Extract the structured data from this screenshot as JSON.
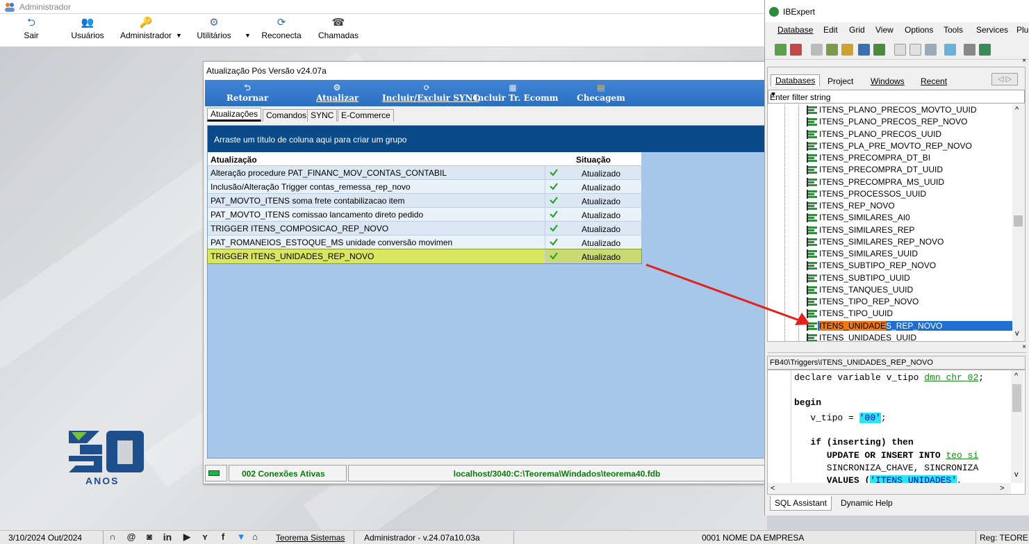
{
  "app": {
    "title": "Administrador",
    "toolbar": [
      {
        "label": "Sair",
        "icon": "exit-icon"
      },
      {
        "label": "Usuários",
        "icon": "users-icon"
      },
      {
        "label": "Administrador",
        "icon": "key-icon"
      },
      {
        "label": "Utilitários",
        "icon": "tools-icon"
      },
      {
        "label": "Reconecta",
        "icon": "refresh-icon"
      },
      {
        "label": "Chamadas",
        "icon": "headset-icon"
      }
    ]
  },
  "logo": {
    "text": "ANOS",
    "number": "30"
  },
  "dialog": {
    "title": "Atualização Pós Versão v24.07a",
    "toolbar": [
      {
        "label": "Retornar",
        "icon": "back-icon"
      },
      {
        "label": "Atualizar",
        "icon": "gear-icon"
      },
      {
        "label": "Incluir/Excluir SYNC",
        "icon": "sync-icon"
      },
      {
        "label": "Incluir Tr. Ecomm",
        "icon": "grid-icon"
      },
      {
        "label": "Checagem",
        "icon": "check-doc-icon"
      }
    ],
    "tabs": [
      "Atualizações",
      "Comandos",
      "SYNC",
      "E-Commerce"
    ],
    "group_hint": "Arraste um título de coluna aqui para criar um grupo",
    "columns": [
      "Atualização",
      "Situação"
    ],
    "rows": [
      {
        "name": "Alteração procedure PAT_FINANC_MOV_CONTAS_CONTABIL",
        "status": "Atualizado"
      },
      {
        "name": "Inclusão/Alteração Trigger contas_remessa_rep_novo",
        "status": "Atualizado"
      },
      {
        "name": "PAT_MOVTO_ITENS soma frete contabilizacao item",
        "status": "Atualizado"
      },
      {
        "name": "PAT_MOVTO_ITENS comissao lancamento direto pedido",
        "status": "Atualizado"
      },
      {
        "name": "TRIGGER ITENS_COMPOSICAO_REP_NOVO",
        "status": "Atualizado"
      },
      {
        "name": "PAT_ROMANEIOS_ESTOQUE_MS unidade conversão movimen",
        "status": "Atualizado"
      },
      {
        "name": "TRIGGER ITENS_UNIDADES_REP_NOVO",
        "status": "Atualizado"
      }
    ],
    "status_connections": "002 Conexões Ativas",
    "status_db": "localhost/3040:C:\\Teorema\\Windados\\teorema40.fdb"
  },
  "ibexpert": {
    "title": "IBExpert",
    "menu": [
      "Database",
      "Edit",
      "Grid",
      "View",
      "Options",
      "Tools",
      "Services",
      "Plu"
    ],
    "tabs": [
      "Databases",
      "Project",
      "Windows",
      "Recent"
    ],
    "filter_placeholder": "Enter filter string",
    "tree": [
      "ITENS_PLANO_PRECOS_MOVTO_UUID",
      "ITENS_PLANO_PRECOS_REP_NOVO",
      "ITENS_PLANO_PRECOS_UUID",
      "ITENS_PLA_PRE_MOVTO_REP_NOVO",
      "ITENS_PRECOMPRA_DT_BI",
      "ITENS_PRECOMPRA_DT_UUID",
      "ITENS_PRECOMPRA_MS_UUID",
      "ITENS_PROCESSOS_UUID",
      "ITENS_REP_NOVO",
      "ITENS_SIMILARES_AI0",
      "ITENS_SIMILARES_REP",
      "ITENS_SIMILARES_REP_NOVO",
      "ITENS_SIMILARES_UUID",
      "ITENS_SUBTIPO_REP_NOVO",
      "ITENS_SUBTIPO_UUID",
      "ITENS_TANQUES_UUID",
      "ITENS_TIPO_REP_NOVO",
      "ITENS_TIPO_UUID"
    ],
    "selected_prefix": "ITENS_UNIDADE",
    "selected_suffix": "S_REP_NOVO",
    "tree_last": "ITENS_UNIDADES_UUID",
    "editor_path": "FB40\\Triggers\\ITENS_UNIDADES_REP_NOVO",
    "code": {
      "l1a": "declare variable v_tipo ",
      "l1b": "dmn_chr_02",
      "l1c": ";",
      "l2": "begin",
      "l3a": "   v_tipo = ",
      "l3b": "'00'",
      "l3c": ";",
      "l4a": "   if (inserting) then",
      "l5a": "      UPDATE OR INSERT INTO ",
      "l5b": "teo_si",
      "l6": "      SINCRONIZA_CHAVE, SINCRONIZA",
      "l7a": "      VALUES (",
      "l7b": "'ITENS_UNIDADES'",
      "l7c": ","
    },
    "bottom_tabs": [
      "SQL Assistant",
      "Dynamic Help"
    ]
  },
  "taskbar": {
    "date": "3/10/2024 Out/2024",
    "company_link": "Teorema Sistemas",
    "version": "Administrador - v.24.07a10.03a",
    "empresa": "0001 NOME DA EMPRESA",
    "reg": "Reg: TEORE"
  },
  "colors": {
    "accent": "#2b6fc0",
    "group_band": "#0b4a88",
    "grid_bg": "#a7c7ea",
    "status_text": "#0a7a0a",
    "arrow": "#e0231c",
    "selected_row": "#d8e660"
  }
}
